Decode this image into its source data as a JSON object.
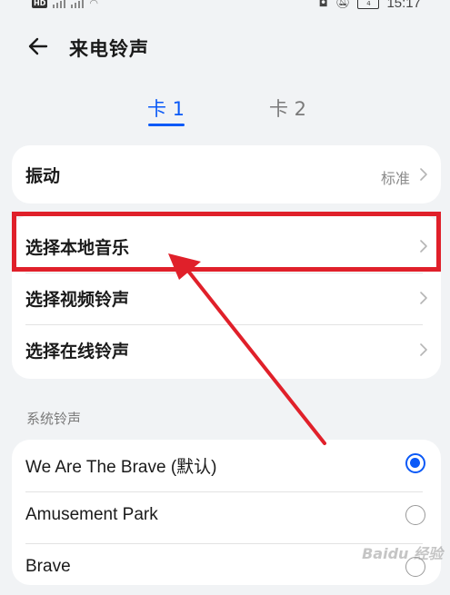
{
  "status_bar": {
    "left_badge": "HD",
    "time": "15:17",
    "battery": "4"
  },
  "header": {
    "back_icon": "arrow-left-icon",
    "title": "来电铃声"
  },
  "tabs": [
    {
      "label": "卡 1",
      "active": true
    },
    {
      "label": "卡 2",
      "active": false
    }
  ],
  "vibration": {
    "label": "振动",
    "value": "标准"
  },
  "ringtone_sources": [
    {
      "label": "选择本地音乐"
    },
    {
      "label": "选择视频铃声"
    },
    {
      "label": "选择在线铃声"
    }
  ],
  "system_ringtones": {
    "section_title": "系统铃声",
    "items": [
      {
        "label": "We Are The Brave (默认)",
        "selected": true
      },
      {
        "label": "Amusement Park",
        "selected": false
      },
      {
        "label": "Brave",
        "selected": false
      }
    ]
  },
  "annotation": {
    "color": "#e0202a",
    "target": "选择本地音乐"
  },
  "watermark": "Baidu 经验",
  "colors": {
    "accent": "#0a59f7",
    "background": "#f1f3f5",
    "annotation": "#e0202a"
  }
}
